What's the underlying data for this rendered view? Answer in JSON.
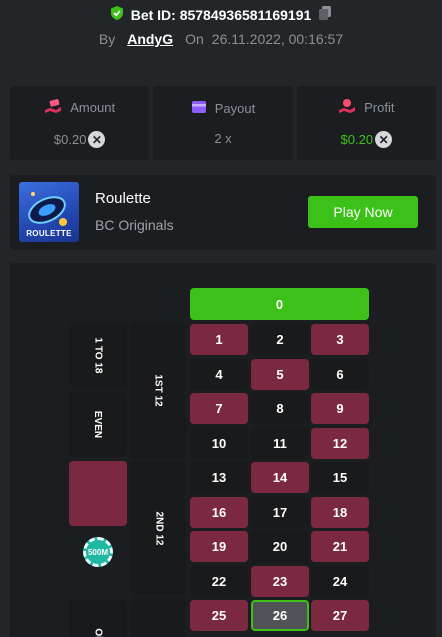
{
  "header": {
    "bet_id_label": "Bet ID: 85784936581169191",
    "by_label": "By",
    "user": "AndyG",
    "on_label": "On",
    "date": "26.11.2022, 00:16:57"
  },
  "stats": {
    "amount": {
      "label": "Amount",
      "value": "$0.20",
      "icon": "money-hand-icon"
    },
    "payout": {
      "label": "Payout",
      "value": "2 x",
      "icon": "wallet-icon"
    },
    "profit": {
      "label": "Profit",
      "value": "$0.20",
      "icon": "profit-hand-icon"
    }
  },
  "game": {
    "title": "Roulette",
    "subtitle": "BC Originals",
    "thumb_label": "ROULETTE",
    "play_label": "Play Now"
  },
  "board": {
    "zero": "0",
    "numbers": [
      {
        "n": "1",
        "c": "red"
      },
      {
        "n": "2",
        "c": "black"
      },
      {
        "n": "3",
        "c": "red"
      },
      {
        "n": "4",
        "c": "black"
      },
      {
        "n": "5",
        "c": "red"
      },
      {
        "n": "6",
        "c": "black"
      },
      {
        "n": "7",
        "c": "red"
      },
      {
        "n": "8",
        "c": "black"
      },
      {
        "n": "9",
        "c": "red"
      },
      {
        "n": "10",
        "c": "black"
      },
      {
        "n": "11",
        "c": "black"
      },
      {
        "n": "12",
        "c": "red"
      },
      {
        "n": "13",
        "c": "black"
      },
      {
        "n": "14",
        "c": "red"
      },
      {
        "n": "15",
        "c": "black"
      },
      {
        "n": "16",
        "c": "red"
      },
      {
        "n": "17",
        "c": "black"
      },
      {
        "n": "18",
        "c": "red"
      },
      {
        "n": "19",
        "c": "red"
      },
      {
        "n": "20",
        "c": "black"
      },
      {
        "n": "21",
        "c": "red"
      },
      {
        "n": "22",
        "c": "black"
      },
      {
        "n": "23",
        "c": "red"
      },
      {
        "n": "24",
        "c": "black"
      },
      {
        "n": "25",
        "c": "red"
      },
      {
        "n": "26",
        "c": "selected"
      },
      {
        "n": "27",
        "c": "red"
      }
    ],
    "dozens": [
      "1ST 12",
      "2ND 12"
    ],
    "side_bets": [
      "1 TO 18",
      "EVEN",
      "ODD"
    ],
    "chip_label": "500M"
  },
  "colors": {
    "accent_green": "#3bc117",
    "red": "#7b2940",
    "black": "#191a1c",
    "background": "#232629",
    "panel": "#1b1d20"
  }
}
